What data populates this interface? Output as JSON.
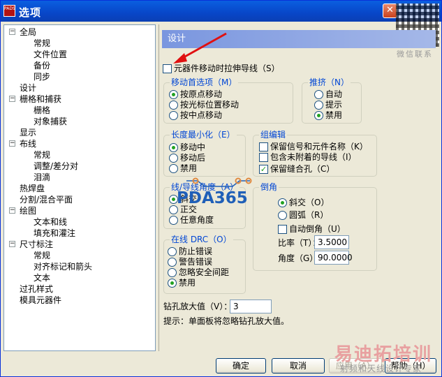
{
  "window": {
    "title": "选项",
    "app_icon_text": "PADS",
    "close": "✕"
  },
  "tree": {
    "items": [
      {
        "label": "全局",
        "level": 0,
        "expander": "−"
      },
      {
        "label": "常规",
        "level": 2
      },
      {
        "label": "文件位置",
        "level": 2
      },
      {
        "label": "备份",
        "level": 2
      },
      {
        "label": "同步",
        "level": 2
      },
      {
        "label": "设计",
        "level": 1,
        "selected": true
      },
      {
        "label": "栅格和捕获",
        "level": 0,
        "expander": "−"
      },
      {
        "label": "栅格",
        "level": 2
      },
      {
        "label": "对象捕获",
        "level": 2
      },
      {
        "label": "显示",
        "level": 1
      },
      {
        "label": "布线",
        "level": 0,
        "expander": "−"
      },
      {
        "label": "常规",
        "level": 2
      },
      {
        "label": "调整/差分对",
        "level": 2
      },
      {
        "label": "泪滴",
        "level": 2
      },
      {
        "label": "热焊盘",
        "level": 1
      },
      {
        "label": "分割/混合平面",
        "level": 1
      },
      {
        "label": "绘图",
        "level": 0,
        "expander": "−"
      },
      {
        "label": "文本和线",
        "level": 2
      },
      {
        "label": "填充和灌注",
        "level": 2
      },
      {
        "label": "尺寸标注",
        "level": 0,
        "expander": "−"
      },
      {
        "label": "常规",
        "level": 2
      },
      {
        "label": "对齐标记和箭头",
        "level": 2
      },
      {
        "label": "文本",
        "level": 2
      },
      {
        "label": "过孔样式",
        "level": 1
      },
      {
        "label": "模具元器件",
        "level": 1
      }
    ]
  },
  "panel": {
    "header": "设计",
    "stretch_traces": "元器件移动时拉伸导线（S）",
    "move_pref": {
      "title": "移动首选项（M）",
      "options": [
        "按原点移动",
        "按光标位置移动",
        "按中点移动"
      ],
      "selected": 0
    },
    "push": {
      "title": "推挤（N）",
      "options": [
        "自动",
        "提示",
        "禁用"
      ],
      "selected": 2
    },
    "length_min": {
      "title": "长度最小化（E）",
      "options": [
        "移动中",
        "移动后",
        "禁用"
      ],
      "selected": 0
    },
    "group": {
      "title": "组编辑",
      "options": [
        {
          "label": "保留信号和元件名称（K）",
          "checked": false
        },
        {
          "label": "包含未附着的导线（I）",
          "checked": false
        },
        {
          "label": "保留缝合孔（C）",
          "checked": true
        }
      ]
    },
    "angle": {
      "title": "线/导线角度（A）",
      "options": [
        "斜交",
        "正交",
        "任意角度"
      ],
      "selected": 0
    },
    "chamfer": {
      "title": "倒角",
      "options": [
        "斜交（O）",
        "圆弧（R）"
      ],
      "selected": 0,
      "auto_label": "自动倒角（U）",
      "auto_checked": false,
      "ratio_label": "比率（T）：",
      "ratio_value": "3.5000",
      "angle_label": "角度（G）：",
      "angle_value": "90.0000"
    },
    "drc": {
      "title": "在线 DRC（O）",
      "options": [
        "防止错误",
        "警告错误",
        "忽略安全间距",
        "禁用"
      ],
      "selected": 3
    },
    "drill": {
      "label": "钻孔放大值（V）：",
      "value": "3"
    },
    "hint": "提示：单面板将忽略钻孔放大值。"
  },
  "buttons": {
    "ok": "确定",
    "cancel": "取消",
    "apply": "应用（A）",
    "help": "帮助（H）"
  },
  "watermarks": {
    "center": "PDA365",
    "bottom": "易迪拓培训",
    "bottom_sub": "射频和天线设计专家",
    "qr_caption": "微信联系"
  }
}
